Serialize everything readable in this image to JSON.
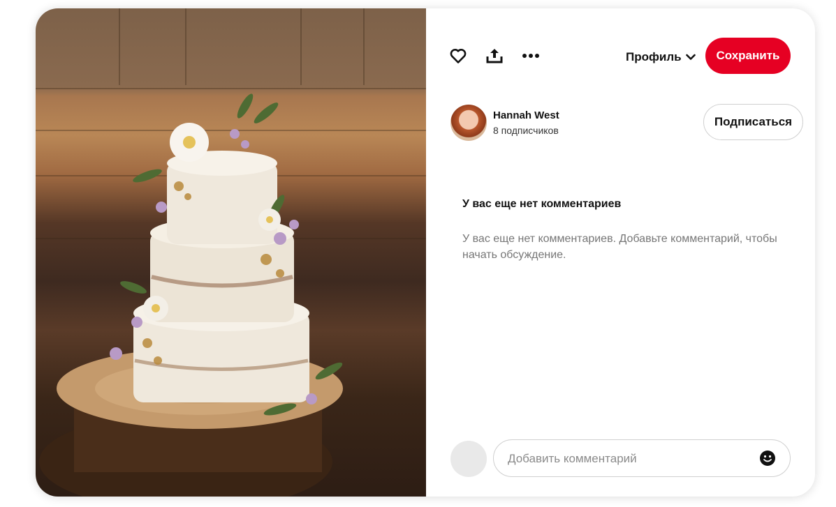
{
  "toolbar": {
    "like_icon": "heart-icon",
    "share_icon": "share-upload-icon",
    "more_icon": "more-dots-icon",
    "profile_label": "Профиль",
    "profile_chevron_icon": "chevron-down-icon",
    "save_label": "Сохранить",
    "accent_color": "#e60023"
  },
  "author": {
    "name": "Hannah West",
    "followers": "8 подписчиков",
    "follow_label": "Подписаться"
  },
  "comments": {
    "title": "У вас еще нет комментариев",
    "empty_text": "У вас еще нет комментариев. Добавьте комментарий, чтобы начать обсуждение.",
    "input_placeholder": "Добавить комментарий",
    "emoji_icon": "emoji-smile-icon"
  }
}
